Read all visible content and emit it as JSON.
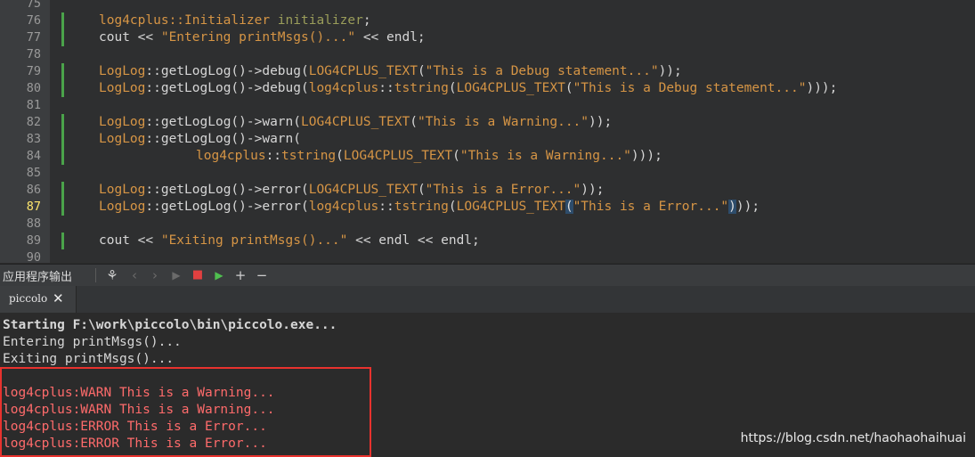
{
  "editor": {
    "lines": [
      {
        "num": "75",
        "text": ""
      },
      {
        "num": "76",
        "html": [
          [
            "t-cls",
            "log4cplus::Initializer"
          ],
          [
            "t-fn",
            " "
          ],
          [
            "t-var",
            "initializer"
          ],
          [
            "t-fn",
            ";"
          ]
        ]
      },
      {
        "num": "77",
        "html": [
          [
            "t-fn",
            "cout << "
          ],
          [
            "t-str",
            "\"Entering printMsgs()...\""
          ],
          [
            "t-fn",
            " << endl;"
          ]
        ]
      },
      {
        "num": "78",
        "text": ""
      },
      {
        "num": "79",
        "html": [
          [
            "t-cls",
            "LogLog"
          ],
          [
            "t-fn",
            "::getLogLog()->debug("
          ],
          [
            "t-mac",
            "LOG4CPLUS_TEXT"
          ],
          [
            "t-fn",
            "("
          ],
          [
            "t-str",
            "\"This is a Debug statement...\""
          ],
          [
            "t-fn",
            "));"
          ]
        ]
      },
      {
        "num": "80",
        "html": [
          [
            "t-cls",
            "LogLog"
          ],
          [
            "t-fn",
            "::getLogLog()->debug("
          ],
          [
            "t-cls",
            "log4cplus"
          ],
          [
            "t-fn",
            "::"
          ],
          [
            "t-cls",
            "tstring"
          ],
          [
            "t-fn",
            "("
          ],
          [
            "t-mac",
            "LOG4CPLUS_TEXT"
          ],
          [
            "t-fn",
            "("
          ],
          [
            "t-str",
            "\"This is a Debug statement...\""
          ],
          [
            "t-fn",
            ")));"
          ]
        ]
      },
      {
        "num": "81",
        "text": ""
      },
      {
        "num": "82",
        "html": [
          [
            "t-cls",
            "LogLog"
          ],
          [
            "t-fn",
            "::getLogLog()->warn("
          ],
          [
            "t-mac",
            "LOG4CPLUS_TEXT"
          ],
          [
            "t-fn",
            "("
          ],
          [
            "t-str",
            "\"This is a Warning...\""
          ],
          [
            "t-fn",
            "));"
          ]
        ]
      },
      {
        "num": "83",
        "html": [
          [
            "t-cls",
            "LogLog"
          ],
          [
            "t-fn",
            "::getLogLog()->warn("
          ]
        ]
      },
      {
        "num": "84",
        "indent": true,
        "html": [
          [
            "t-cls",
            "log4cplus"
          ],
          [
            "t-fn",
            "::"
          ],
          [
            "t-cls",
            "tstring"
          ],
          [
            "t-fn",
            "("
          ],
          [
            "t-mac",
            "LOG4CPLUS_TEXT"
          ],
          [
            "t-fn",
            "("
          ],
          [
            "t-str",
            "\"This is a Warning...\""
          ],
          [
            "t-fn",
            ")));"
          ]
        ]
      },
      {
        "num": "85",
        "text": ""
      },
      {
        "num": "86",
        "html": [
          [
            "t-cls",
            "LogLog"
          ],
          [
            "t-fn",
            "::getLogLog()->error("
          ],
          [
            "t-mac",
            "LOG4CPLUS_TEXT"
          ],
          [
            "t-fn",
            "("
          ],
          [
            "t-str",
            "\"This is a Error...\""
          ],
          [
            "t-fn",
            "));"
          ]
        ]
      },
      {
        "num": "87",
        "current": true,
        "html": [
          [
            "t-cls",
            "LogLog"
          ],
          [
            "t-fn",
            "::getLogLog()->error("
          ],
          [
            "t-cls",
            "log4cplus"
          ],
          [
            "t-fn",
            "::"
          ],
          [
            "t-cls",
            "tstring"
          ],
          [
            "t-fn",
            "("
          ],
          [
            "t-mac",
            "LOG4CPLUS_TEXT"
          ],
          [
            "t-brk",
            "("
          ],
          [
            "t-str",
            "\"This is a Error...\""
          ],
          [
            "t-brk",
            ")"
          ],
          [
            "t-fn",
            "));"
          ]
        ]
      },
      {
        "num": "88",
        "text": ""
      },
      {
        "num": "89",
        "html": [
          [
            "t-fn",
            "cout << "
          ],
          [
            "t-str",
            "\"Exiting printMsgs()...\""
          ],
          [
            "t-fn",
            " << endl << endl;"
          ]
        ]
      },
      {
        "num": "90",
        "text": ""
      }
    ]
  },
  "toolbar": {
    "title": "应用程序输出"
  },
  "tabs": [
    {
      "label": "piccolo",
      "close": "✕"
    }
  ],
  "output": {
    "lines": [
      {
        "text": "Starting F:\\work\\piccolo\\bin\\piccolo.exe...",
        "style": "bold"
      },
      {
        "text": "Entering printMsgs()...",
        "style": "normal"
      },
      {
        "text": "Exiting printMsgs()...",
        "style": "normal"
      },
      {
        "text": "",
        "style": "normal"
      },
      {
        "text": "log4cplus:WARN This is a Warning...",
        "style": "err"
      },
      {
        "text": "log4cplus:WARN This is a Warning...",
        "style": "err"
      },
      {
        "text": "log4cplus:ERROR This is a Error...",
        "style": "err"
      },
      {
        "text": "log4cplus:ERROR This is a Error...",
        "style": "err"
      }
    ]
  },
  "watermark": "https://blog.csdn.net/haohaohaihuai"
}
